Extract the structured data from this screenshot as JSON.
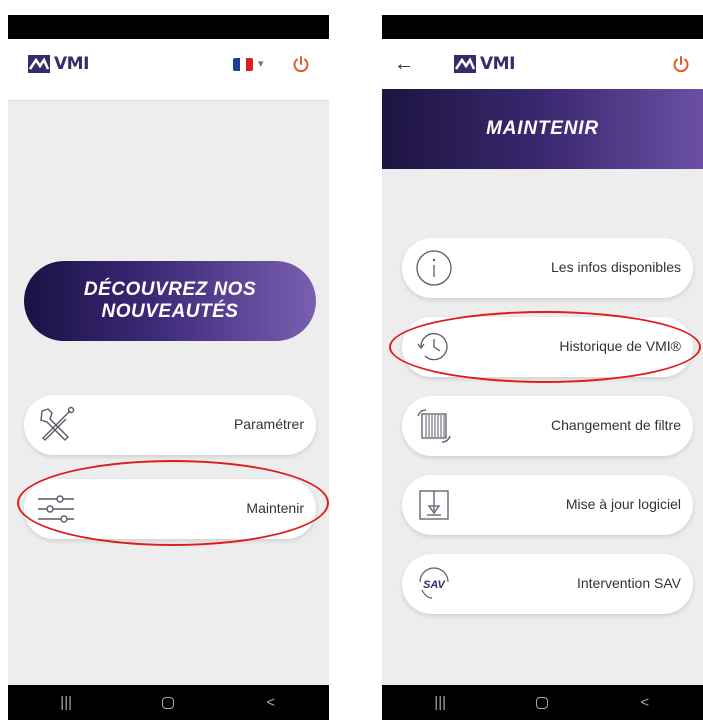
{
  "brand": {
    "logo_text": "VMI"
  },
  "left_screen": {
    "promo": {
      "line1": "DÉCOUVREZ NOS",
      "line2": "NOUVEAUTÉS"
    },
    "menu": [
      {
        "label": "Paramétrer",
        "icon": "tools-icon"
      },
      {
        "label": "Maintenir",
        "icon": "sliders-icon"
      }
    ]
  },
  "right_screen": {
    "title": "MAINTENIR",
    "menu": [
      {
        "label": "Les infos disponibles",
        "icon": "info-icon"
      },
      {
        "label": "Historique de VMI®",
        "icon": "history-icon"
      },
      {
        "label": "Changement de filtre",
        "icon": "filter-icon"
      },
      {
        "label": "Mise à jour logiciel",
        "icon": "download-icon"
      },
      {
        "label": "Intervention SAV",
        "icon": "sav-icon"
      }
    ],
    "sav_icon_text": "SAV"
  },
  "nav": {
    "recent": "|||",
    "back": "<"
  },
  "colors": {
    "brand_purple": "#3a2a6b",
    "highlight_red": "#e01b1b",
    "power_orange": "#e05a2a"
  }
}
